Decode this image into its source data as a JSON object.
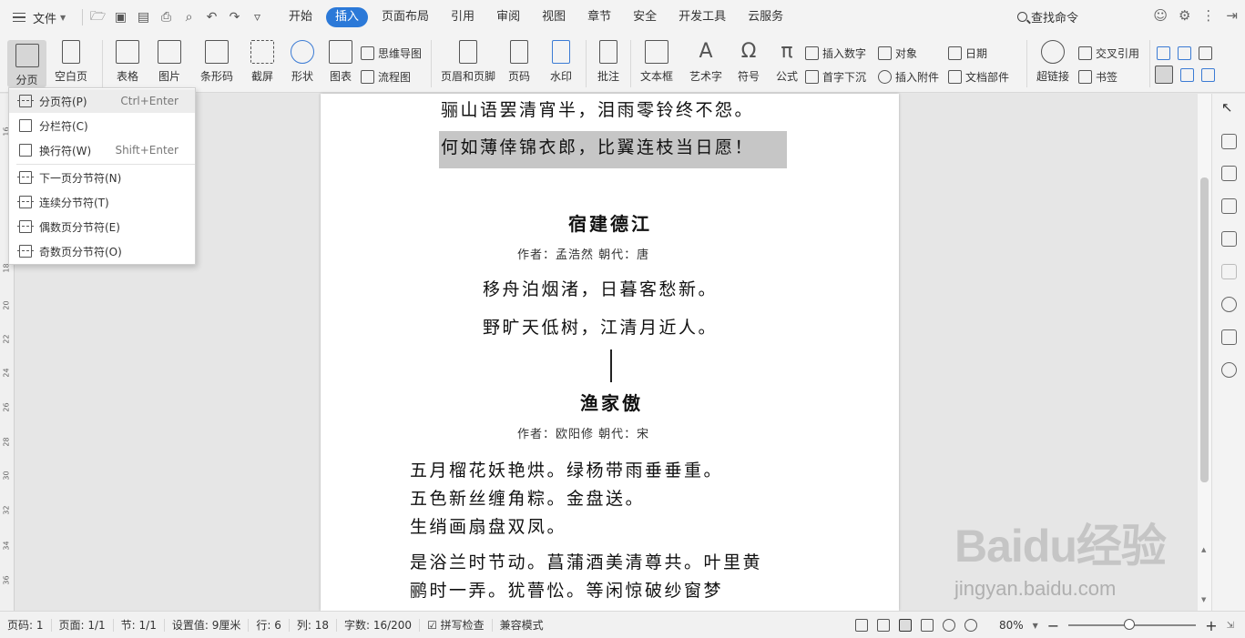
{
  "menubar": {
    "file_label": "文件",
    "tabs": [
      {
        "label": "开始",
        "active": false
      },
      {
        "label": "插入",
        "active": true
      },
      {
        "label": "页面布局",
        "active": false
      },
      {
        "label": "引用",
        "active": false
      },
      {
        "label": "审阅",
        "active": false
      },
      {
        "label": "视图",
        "active": false
      },
      {
        "label": "章节",
        "active": false
      },
      {
        "label": "安全",
        "active": false
      },
      {
        "label": "开发工具",
        "active": false
      },
      {
        "label": "云服务",
        "active": false
      }
    ],
    "search_label": "查找命令",
    "accent_color": "#2b79d8"
  },
  "ribbon": {
    "page_break": "分页",
    "blank_page": "空白页",
    "table": "表格",
    "picture": "图片",
    "barcode": "条形码",
    "screenshot": "截屏",
    "shapes": "形状",
    "chart": "图表",
    "mindmap": "思维导图",
    "flowchart": "流程图",
    "header_footer": "页眉和页脚",
    "page_number": "页码",
    "watermark": "水印",
    "comment": "批注",
    "textbox": "文本框",
    "wordart": "艺术字",
    "symbol": "符号",
    "formula": "公式",
    "insert_number": "插入数字",
    "drop_cap": "首字下沉",
    "object": "对象",
    "attachment": "插入附件",
    "date": "日期",
    "doc_parts": "文档部件",
    "hyperlink": "超链接",
    "cross_ref": "交叉引用",
    "bookmark": "书签"
  },
  "dropdown": {
    "items": [
      {
        "label": "分页符(P)",
        "shortcut": "Ctrl+Enter"
      },
      {
        "label": "分栏符(C)",
        "shortcut": ""
      },
      {
        "label": "换行符(W)",
        "shortcut": "Shift+Enter"
      },
      {
        "label": "下一页分节符(N)",
        "shortcut": ""
      },
      {
        "label": "连续分节符(T)",
        "shortcut": ""
      },
      {
        "label": "偶数页分节符(E)",
        "shortcut": ""
      },
      {
        "label": "奇数页分节符(O)",
        "shortcut": ""
      }
    ]
  },
  "ruler": {
    "marks": [
      "16",
      "18",
      "20",
      "22",
      "24",
      "26",
      "28",
      "30",
      "32",
      "34",
      "36"
    ]
  },
  "document": {
    "line1": "骊山语罢清宵半，泪雨零铃终不怨。",
    "line2": "何如薄倖锦衣郎，比翼连枝当日愿！",
    "poem2_title": "宿建德江",
    "poem2_meta": "作者：孟浩然     朝代：唐",
    "poem2_line1": "移舟泊烟渚，日暮客愁新。",
    "poem2_line2": "野旷天低树，江清月近人。",
    "poem3_title": "渔家傲",
    "poem3_meta": "作者：欧阳修     朝代：宋",
    "poem3_line1": "五月榴花妖艳烘。绿杨带雨垂垂重。",
    "poem3_line2": "五色新丝缠角粽。金盘送。",
    "poem3_line3": "生绡画扇盘双凤。",
    "poem3_line4": "是浴兰时节动。菖蒲酒美清尊共。叶里黄",
    "poem3_line5": "鹂时一弄。犹瞢忪。等闲惊破纱窗梦"
  },
  "statusbar": {
    "page_no": "页码: 1",
    "pages": "页面: 1/1",
    "section": "节: 1/1",
    "setting": "设置值: 9厘米",
    "row": "行: 6",
    "col": "列: 18",
    "wordcount": "字数: 16/200",
    "spellcheck": "拼写检查",
    "compat": "兼容模式",
    "zoom": "80%",
    "zoom_level_fraction": 0.48
  },
  "watermark": {
    "logo": "Baidu经验",
    "url": "jingyan.baidu.com"
  }
}
